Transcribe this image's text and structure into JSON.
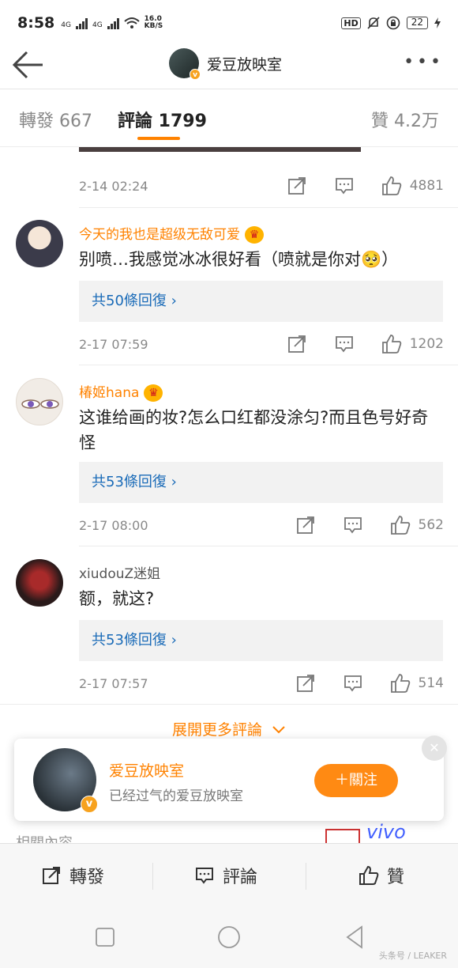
{
  "status_bar": {
    "time": "8:58",
    "net1": "4G",
    "net2": "4G",
    "speed_value": "16.0",
    "speed_unit": "KB/S",
    "hd": "HD",
    "battery": "22"
  },
  "nav": {
    "title": "爱豆放映室"
  },
  "tabs": {
    "repost": "轉發 667",
    "comment": "評論 1799",
    "like": "贊 4.2万"
  },
  "comments": [
    {
      "date": "2-14 02:24",
      "likes": "4881"
    },
    {
      "username": "今天的我也是超级无敌可爱",
      "text": "别喷…我感觉冰冰很好看（喷就是你对🥺）",
      "replies": "共50條回復",
      "date": "2-17 07:59",
      "likes": "1202"
    },
    {
      "username": "椿姬hana",
      "text": "这谁给画的妆?怎么口红都没涂匀?而且色号好奇怪",
      "replies": "共53條回復",
      "date": "2-17 08:00",
      "likes": "562"
    },
    {
      "username": "xiudouZ迷姐",
      "text": "额，就这?",
      "replies": "共53條回復",
      "date": "2-17 07:57",
      "likes": "514"
    }
  ],
  "expand_label": "展開更多評論",
  "popup": {
    "name": "爱豆放映室",
    "desc": "已经过气的爱豆放映室",
    "follow": "＋關注"
  },
  "related": "相關內容",
  "ad_brand": "vivo",
  "toolbar": {
    "repost": "轉發",
    "comment": "評論",
    "like": "贊"
  },
  "watermark": "头条号 / LEAKER",
  "colors": {
    "accent": "#ff8200",
    "link": "#1a6bb8"
  }
}
